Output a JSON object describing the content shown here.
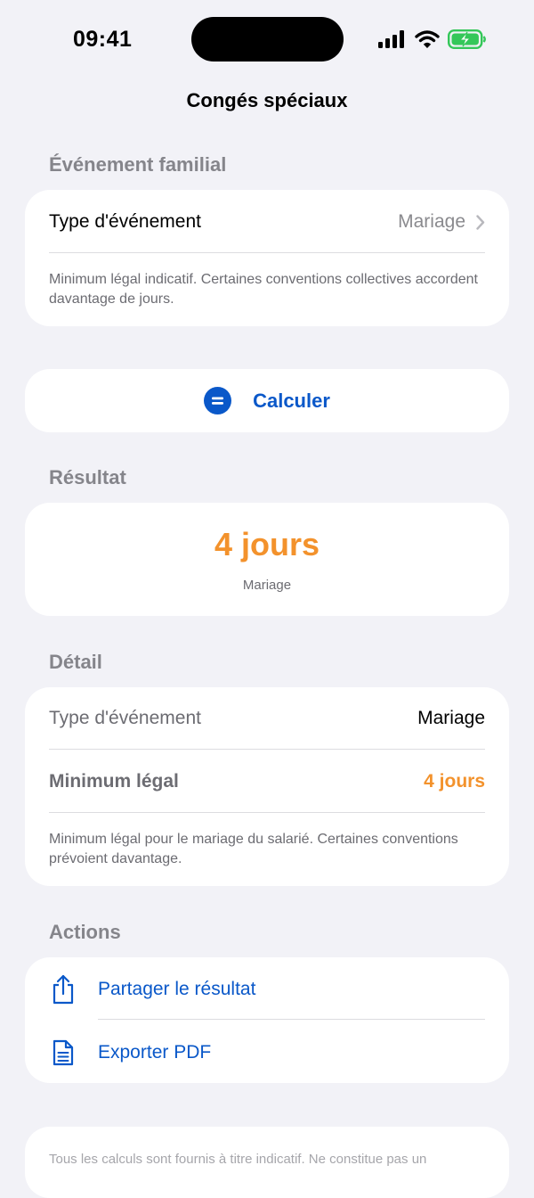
{
  "status": {
    "time": "09:41"
  },
  "nav": {
    "title": "Congés spéciaux"
  },
  "family_event": {
    "header": "Événement familial",
    "type_label": "Type d'événement",
    "type_value": "Mariage",
    "note": "Minimum légal indicatif. Certaines conventions collectives accordent davantage de jours."
  },
  "calculate": {
    "label": "Calculer",
    "icon": "equals-circle-icon"
  },
  "result": {
    "header": "Résultat",
    "value": "4 jours",
    "subtitle": "Mariage"
  },
  "detail": {
    "header": "Détail",
    "type_label": "Type d'événement",
    "type_value": "Mariage",
    "min_label": "Minimum légal",
    "min_value": "4 jours",
    "note": "Minimum légal pour le mariage du salarié. Certaines conventions prévoient davantage."
  },
  "actions": {
    "header": "Actions",
    "share_label": "Partager le résultat",
    "export_label": "Exporter PDF"
  },
  "footer": {
    "text": "Tous les calculs sont fournis à titre indicatif. Ne constitue pas un"
  },
  "colors": {
    "accent_blue": "#0a58c9",
    "result_orange": "#f3922c",
    "battery_green": "#34c759"
  }
}
